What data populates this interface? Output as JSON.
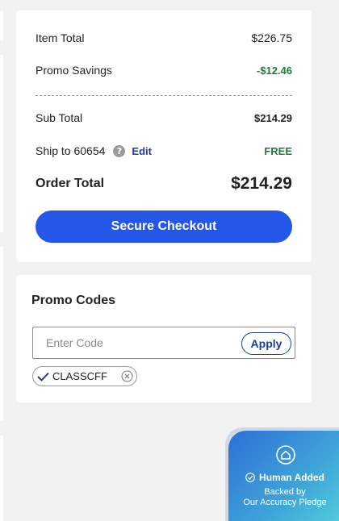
{
  "summary": {
    "item_total_label": "Item Total",
    "item_total_value": "$226.75",
    "promo_savings_label": "Promo Savings",
    "promo_savings_value": "-$12.46",
    "subtotal_label": "Sub Total",
    "subtotal_value": "$214.29",
    "ship_label": "Ship to 60654",
    "help_icon": "question-circle-icon",
    "edit_label": "Edit",
    "shipping_value": "FREE",
    "order_total_label": "Order Total",
    "order_total_value": "$214.29",
    "checkout_label": "Secure Checkout"
  },
  "promo": {
    "title": "Promo Codes",
    "input_value": "",
    "input_placeholder": "Enter Code",
    "apply_label": "Apply",
    "applied_code": "CLASSCFF"
  },
  "badge": {
    "title": "Human Added",
    "line1": "Backed by",
    "line2": "Our Accuracy Pledge"
  },
  "colors": {
    "accent_blue": "#2456e8",
    "link_blue": "#1a3e9a",
    "savings_green": "#1f7a3d"
  }
}
